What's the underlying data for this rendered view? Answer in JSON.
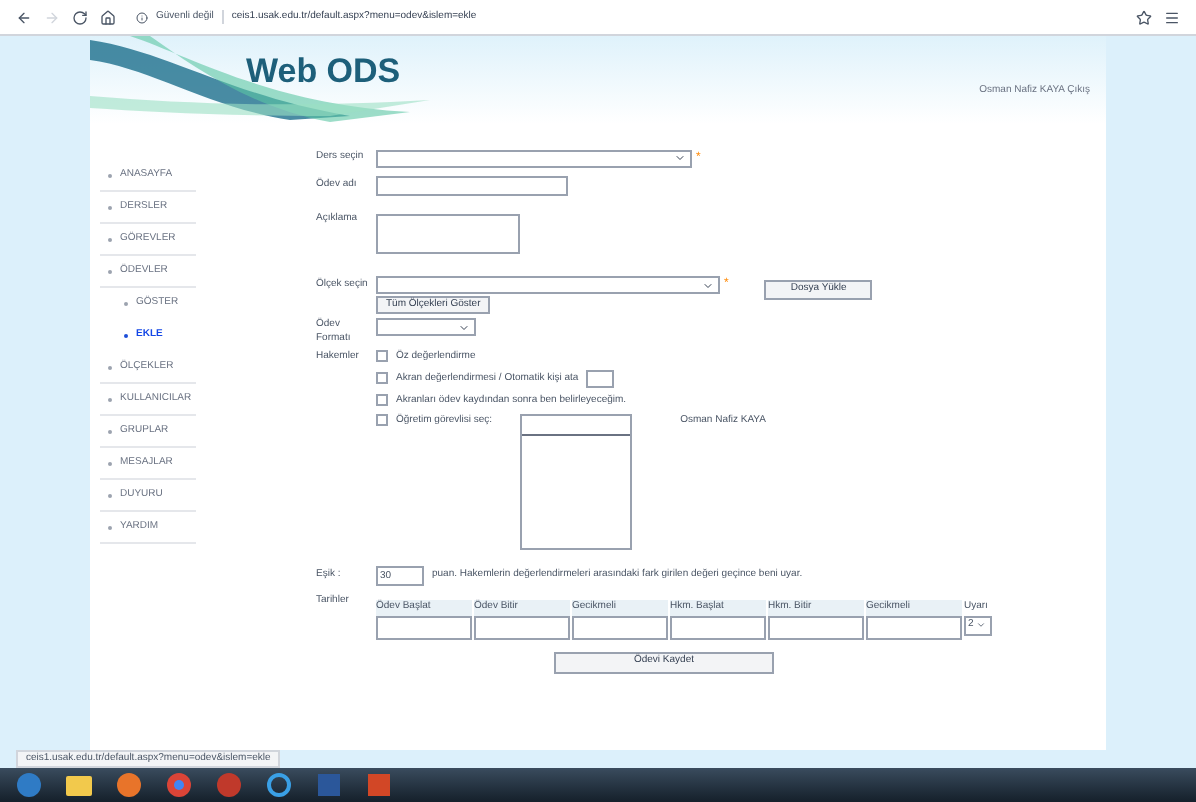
{
  "browser": {
    "security": "Güvenli değil",
    "url": "ceis1.usak.edu.tr/default.aspx?menu=odev&islem=ekle"
  },
  "header": {
    "logo": "Web ODS",
    "user": "Osman Nafiz KAYA Çıkış"
  },
  "sidebar": {
    "items": [
      {
        "label": "ANASAYFA",
        "selected": false
      },
      {
        "label": "DERSLER",
        "selected": false
      },
      {
        "label": "GÖREVLER",
        "selected": false
      },
      {
        "label": "ÖDEVLER",
        "selected": false,
        "children": [
          {
            "label": "GÖSTER",
            "selected": false
          },
          {
            "label": "EKLE",
            "selected": true
          }
        ]
      },
      {
        "label": "ÖLÇEKLER",
        "selected": false
      },
      {
        "label": "KULLANICILAR",
        "selected": false
      },
      {
        "label": "GRUPLAR",
        "selected": false
      },
      {
        "label": "MESAJLAR",
        "selected": false
      },
      {
        "label": "DUYURU",
        "selected": false
      },
      {
        "label": "YARDIM",
        "selected": false
      }
    ]
  },
  "form": {
    "course_label": "Ders seçin",
    "required_mark": "*",
    "name_label": "Ödev adı",
    "description_label": "Açıklama",
    "scale_label": "Ölçek seçin",
    "scale_required_mark": "*",
    "show_scales_button": "Tüm Ölçekleri Göster",
    "upload_button": "Dosya Yükle",
    "format_label": "Ödev Formatı",
    "reviewers_label": "Hakemler",
    "reviewer_options": [
      {
        "kind": "plain",
        "label": "Öz değerlendirme",
        "checked": false
      },
      {
        "kind": "with_input",
        "label": "Akran değerlendirmesi  / Otomatik kişi ata",
        "checked": false
      },
      {
        "kind": "plain",
        "label": "Akranları ödev kaydından sonra ben belirleyeceğim.",
        "checked": false
      },
      {
        "kind": "with_list",
        "label": "Öğretim görevlisi seç:",
        "checked": false
      }
    ],
    "instructor_name": "Osman Nafiz KAYA",
    "threshold_label": "Eşik :",
    "threshold_value": "30",
    "threshold_text": "puan. Hakemlerin değerlendirmeleri arasındaki fark girilen değeri geçince beni uyar.",
    "dates_label": "Tarihler",
    "date_columns": [
      "Ödev Başlat",
      "Ödev Bitir",
      "Gecikmeli",
      "Hkm. Başlat",
      "Hkm. Bitir",
      "Gecikmeli"
    ],
    "warning_label": "Uyarı",
    "warning_value": "2",
    "save_button": "Ödevi Kaydet"
  },
  "status_bar": {
    "url": "ceis1.usak.edu.tr/default.aspx?menu=odev&islem=ekle"
  }
}
